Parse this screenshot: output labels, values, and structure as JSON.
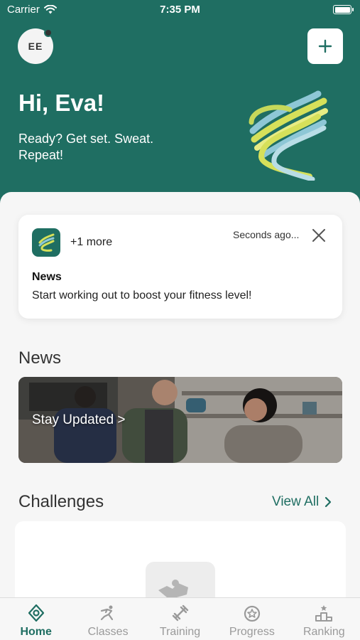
{
  "status_bar": {
    "carrier": "Carrier",
    "time": "7:35 PM"
  },
  "header": {
    "avatar_initials": "EE",
    "greeting": "Hi, Eva!",
    "tagline": "Ready? Get set. Sweat. Repeat!"
  },
  "notification": {
    "more": "+1 more",
    "time": "Seconds ago...",
    "title": "News",
    "body": "Start working out to boost your fitness level!"
  },
  "news": {
    "heading": "News",
    "banner_label": "Stay Updated >"
  },
  "challenges": {
    "heading": "Challenges",
    "view_all": "View All"
  },
  "tabs": [
    {
      "label": "Home",
      "icon": "home-icon",
      "active": true
    },
    {
      "label": "Classes",
      "icon": "classes-icon",
      "active": false
    },
    {
      "label": "Training",
      "icon": "training-icon",
      "active": false
    },
    {
      "label": "Progress",
      "icon": "progress-icon",
      "active": false
    },
    {
      "label": "Ranking",
      "icon": "ranking-icon",
      "active": false
    }
  ],
  "colors": {
    "brand": "#1f6e62",
    "accent_yellow": "#d6e05a",
    "accent_blue": "#8ec7d6"
  }
}
